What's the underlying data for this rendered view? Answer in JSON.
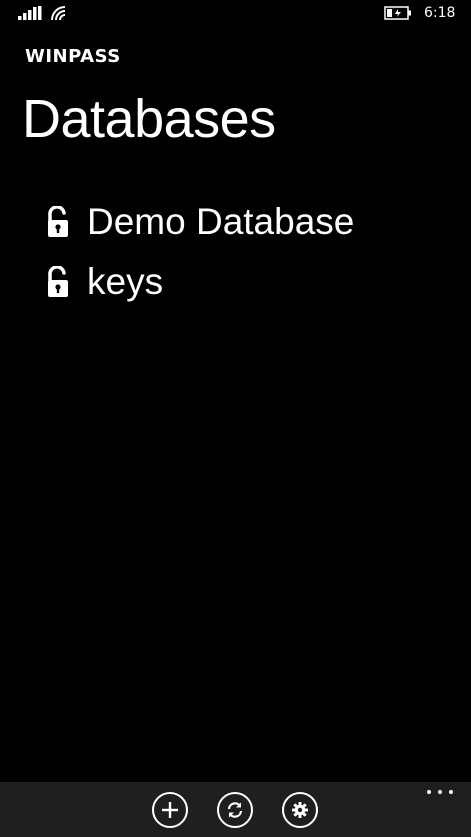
{
  "status_bar": {
    "time": "6:18",
    "icons": [
      "signal-icon",
      "wifi-icon",
      "battery-charging-icon"
    ]
  },
  "header": {
    "app_name": "WINPASS",
    "page_title": "Databases"
  },
  "databases": [
    {
      "name": "Demo Database",
      "icon": "unlocked-padlock-icon"
    },
    {
      "name": "keys",
      "icon": "unlocked-padlock-icon"
    }
  ],
  "app_bar": {
    "buttons": [
      {
        "icon": "add-icon"
      },
      {
        "icon": "refresh-icon"
      },
      {
        "icon": "settings-icon"
      }
    ],
    "more_icon": "ellipsis-icon"
  },
  "colors": {
    "background": "#000000",
    "foreground": "#ffffff",
    "app_bar": "#1f1f1f"
  }
}
